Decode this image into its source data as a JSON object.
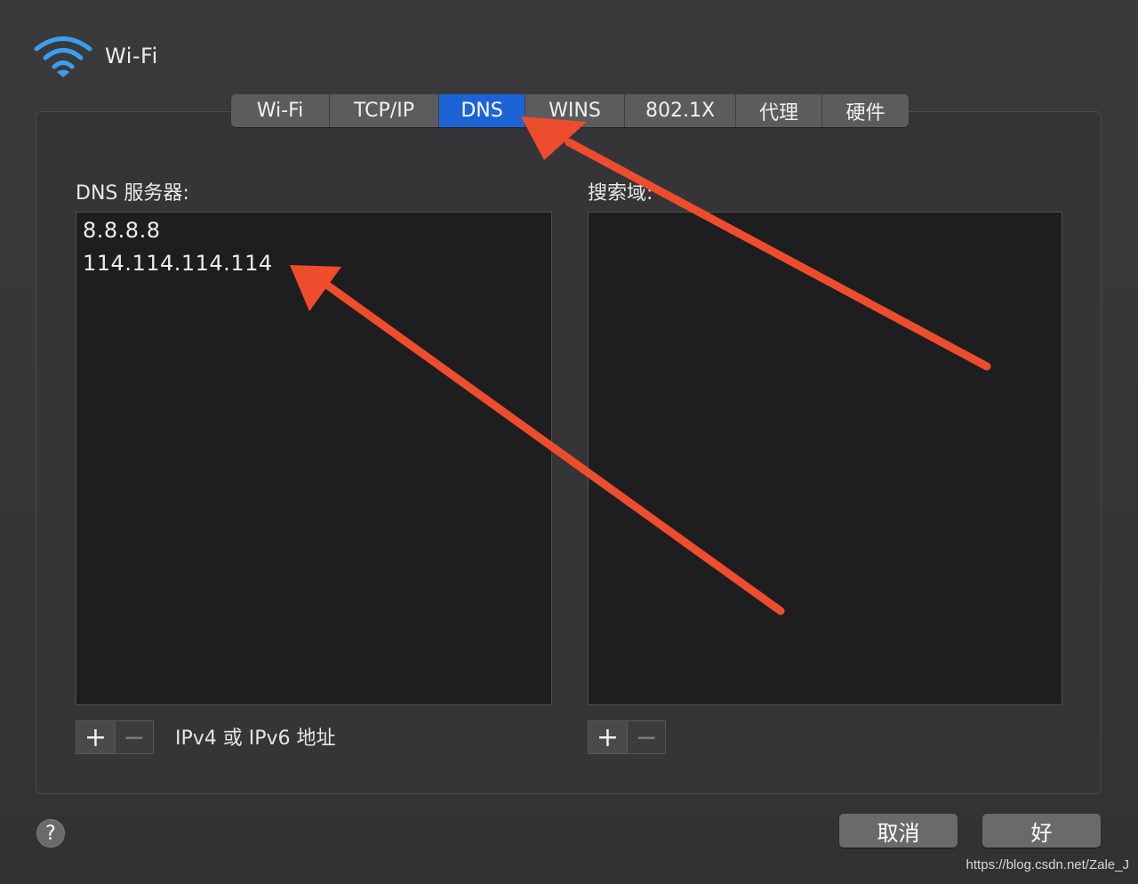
{
  "header": {
    "title": "Wi-Fi",
    "icon": "wifi-icon"
  },
  "tabs": [
    {
      "label": "Wi-Fi",
      "active": false
    },
    {
      "label": "TCP/IP",
      "active": false
    },
    {
      "label": "DNS",
      "active": true
    },
    {
      "label": "WINS",
      "active": false
    },
    {
      "label": "802.1X",
      "active": false
    },
    {
      "label": "代理",
      "active": false
    },
    {
      "label": "硬件",
      "active": false
    }
  ],
  "dns": {
    "label": "DNS 服务器:",
    "servers": [
      "8.8.8.8",
      "114.114.114.114"
    ],
    "add": "+",
    "remove": "−",
    "hint": "IPv4 或 IPv6 地址"
  },
  "search": {
    "label": "搜索域:",
    "add": "+",
    "remove": "−"
  },
  "footer": {
    "help": "?",
    "cancel": "取消",
    "ok": "好"
  },
  "watermark": "https://blog.csdn.net/Zale_J",
  "colors": {
    "accent": "#1c63d6",
    "annotation": "#ee4d2d"
  }
}
